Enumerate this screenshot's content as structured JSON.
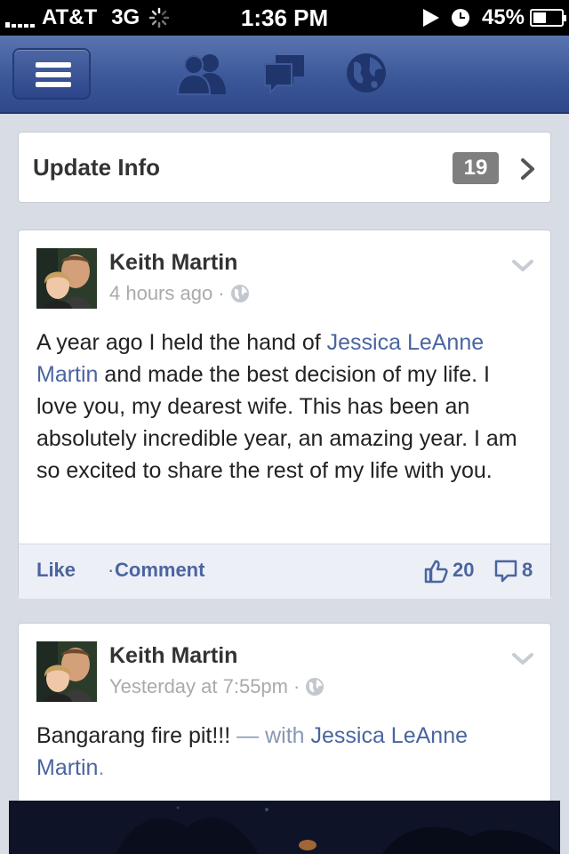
{
  "status_bar": {
    "carrier": "AT&T",
    "network": "3G",
    "time": "1:36 PM",
    "battery": "45%",
    "battery_level": 0.45
  },
  "nav": {
    "menu_icon": "menu-icon",
    "friend_requests_icon": "friends-icon",
    "messages_icon": "messages-icon",
    "notifications_icon": "globe-icon"
  },
  "update_info": {
    "label": "Update Info",
    "count": "19"
  },
  "posts": [
    {
      "author": "Keith Martin",
      "time": "4 hours ago",
      "text_segments": [
        {
          "type": "text",
          "value": "A year ago I held the hand of "
        },
        {
          "type": "link",
          "value": "Jessica LeAnne Martin"
        },
        {
          "type": "text",
          "value": " and made the best decision of my life. I love you, my dearest wife. This has been an absolutely incredible year, an amazing year. I am so excited to share the rest of my life with you."
        }
      ],
      "actions": {
        "like": "Like",
        "separator": "·",
        "comment": "Comment"
      },
      "likes": "20",
      "comments": "8"
    },
    {
      "author": "Keith Martin",
      "time": "Yesterday at 7:55pm",
      "text_segments": [
        {
          "type": "text",
          "value": "Bangarang fire pit!!! "
        },
        {
          "type": "with",
          "value": "— with "
        },
        {
          "type": "link",
          "value": "Jessica LeAnne Martin"
        },
        {
          "type": "with",
          "value": "."
        }
      ]
    }
  ],
  "colors": {
    "facebook_blue": "#3b5898",
    "link": "#4a65a0",
    "background": "#d8dce4"
  }
}
